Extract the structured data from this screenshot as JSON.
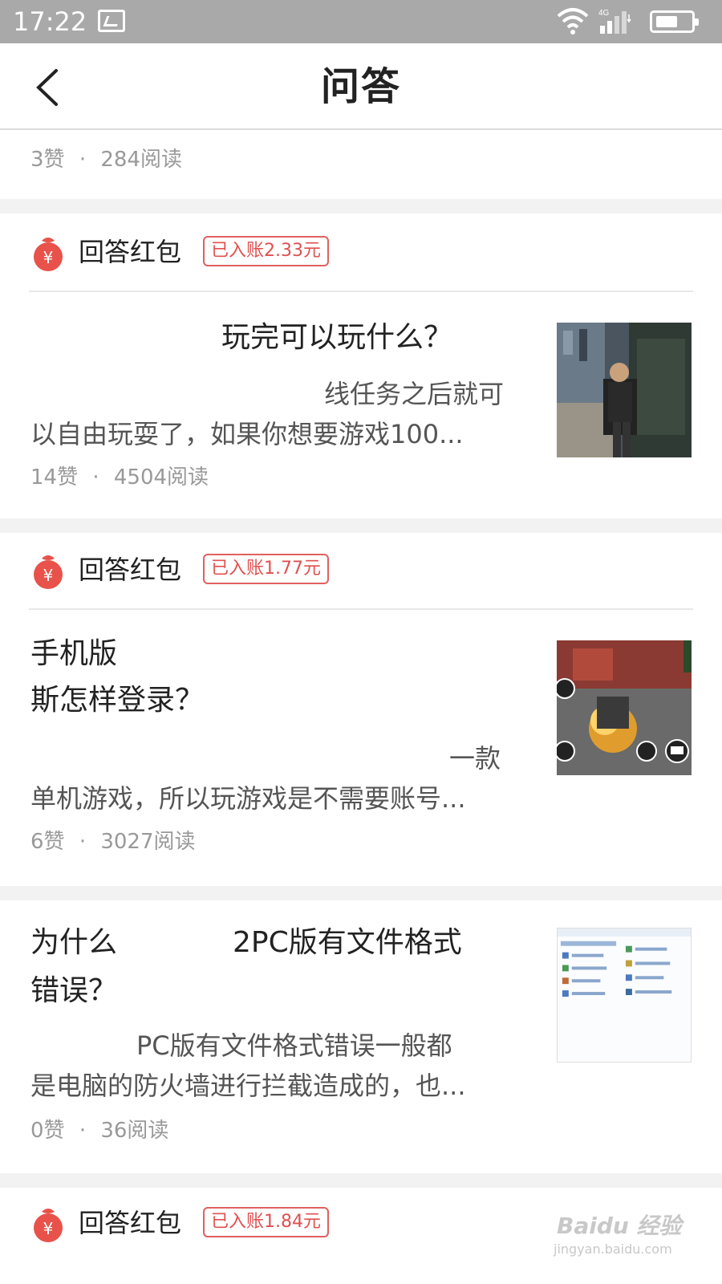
{
  "status_bar": {
    "time": "17:22",
    "network": "4G"
  },
  "nav": {
    "title_part1": "问",
    "title_part2": "答"
  },
  "top_meta": {
    "likes": "3赞",
    "separator": "·",
    "reads": "284阅读"
  },
  "cards": [
    {
      "hb_label": "回答红包",
      "hb_badge": "已入账2.33元",
      "title_line1": "玩完可以玩什么？",
      "body_line1": "线任务之后就可",
      "body_line2": "以自由玩耍了，如果你想要游戏100...",
      "likes": "14赞",
      "reads": "4504阅读",
      "thumb_icon": "game-street-thumbnail"
    },
    {
      "hb_label": "回答红包",
      "hb_badge": "已入账1.77元",
      "title_line1": "手机版",
      "title_line2": "斯怎样登录？",
      "body_line1": "一款",
      "body_line2": "单机游戏，所以玩游戏是不需要账号...",
      "likes": "6赞",
      "reads": "3027阅读",
      "thumb_icon": "game-mobile-thumbnail"
    },
    {
      "title_line1a": "为什么",
      "title_line1b": "2PC版有文件格式",
      "title_line2": "错误？",
      "body_line1": "PC版有文件格式错误一般都",
      "body_line2": "是电脑的防火墙进行拦截造成的，也...",
      "likes": "0赞",
      "reads": "36阅读",
      "thumb_icon": "control-panel-thumbnail"
    },
    {
      "hb_label": "回答红包",
      "hb_badge": "已入账1.84元"
    }
  ],
  "watermark": {
    "text": "Baidu 经验",
    "url": "jingyan.baidu.com"
  },
  "colors": {
    "accent": "#f5a623",
    "red": "#e05050",
    "gray_text": "#999999"
  }
}
